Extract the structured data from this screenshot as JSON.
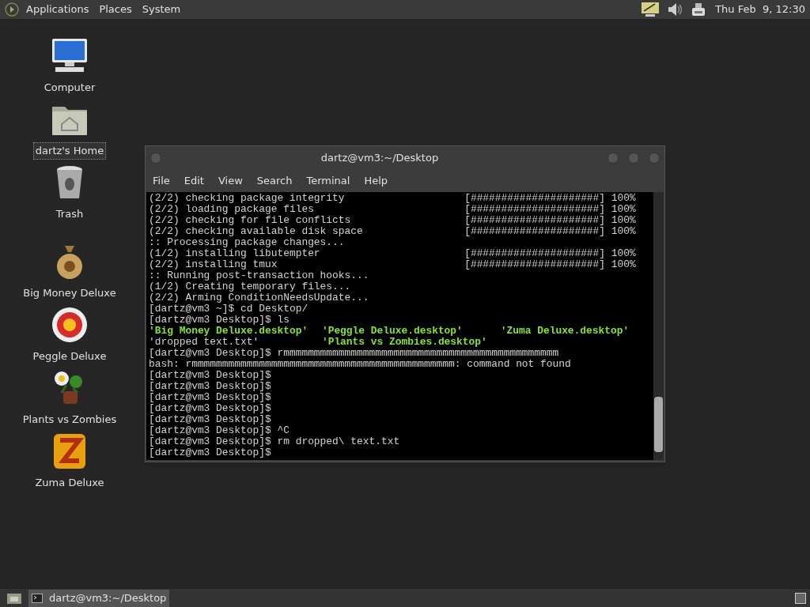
{
  "top_panel": {
    "menus": [
      "Applications",
      "Places",
      "System"
    ],
    "clock": "Thu Feb  9, 12:30"
  },
  "desktop_icons": [
    {
      "kind": "computer",
      "label": "Computer",
      "selected": false
    },
    {
      "kind": "home",
      "label": "dartz's Home",
      "selected": true
    },
    {
      "kind": "trash",
      "label": "Trash",
      "selected": false
    },
    {
      "kind": "money",
      "label": "Big Money Deluxe",
      "selected": false
    },
    {
      "kind": "peggle",
      "label": "Peggle Deluxe",
      "selected": false
    },
    {
      "kind": "plants",
      "label": "Plants vs Zombies",
      "selected": false
    },
    {
      "kind": "zuma",
      "label": "Zuma Deluxe",
      "selected": false
    }
  ],
  "terminal": {
    "title": "dartz@vm3:~/Desktop",
    "menu": [
      "File",
      "Edit",
      "View",
      "Search",
      "Terminal",
      "Help"
    ],
    "lines": [
      {
        "text": "(2/2) checking package integrity",
        "progress": "[#####################]",
        "percent": "100%"
      },
      {
        "text": "(2/2) loading package files",
        "progress": "[#####################]",
        "percent": "100%"
      },
      {
        "text": "(2/2) checking for file conflicts",
        "progress": "[#####################]",
        "percent": "100%"
      },
      {
        "text": "(2/2) checking available disk space",
        "progress": "[#####################]",
        "percent": "100%"
      },
      {
        "text": ":: Processing package changes..."
      },
      {
        "text": "(1/2) installing libutempter",
        "progress": "[#####################]",
        "percent": "100%"
      },
      {
        "text": "(2/2) installing tmux",
        "progress": "[#####################]",
        "percent": "100%"
      },
      {
        "text": ":: Running post-transaction hooks..."
      },
      {
        "text": "(1/2) Creating temporary files..."
      },
      {
        "text": "(2/2) Arming ConditionNeedsUpdate..."
      },
      {
        "text": "[dartz@vm3 ~]$ cd Desktop/"
      },
      {
        "text": "[dartz@vm3 Desktop]$ ls"
      },
      {
        "files": [
          {
            "text": "'Big Money Deluxe.desktop'",
            "executable": true
          },
          {
            "text": "'Peggle Deluxe.desktop'",
            "executable": true
          },
          {
            "text": "'Zuma Deluxe.desktop'",
            "executable": true
          }
        ]
      },
      {
        "files": [
          {
            "text": "'dropped text.txt'",
            "executable": false
          },
          {
            "text": "'Plants vs Zombies.desktop'",
            "executable": true
          }
        ]
      },
      {
        "text": "[dartz@vm3 Desktop]$ rmmmmmmmmmmmmmmmmmmmmmmmmmmmmmmmmmmmmmmmmmmmmm"
      },
      {
        "text": "bash: rmmmmmmmmmmmmmmmmmmmmmmmmmmmmmmmmmmmmmmmmmmm: command not found"
      },
      {
        "text": "[dartz@vm3 Desktop]$"
      },
      {
        "text": "[dartz@vm3 Desktop]$"
      },
      {
        "text": "[dartz@vm3 Desktop]$"
      },
      {
        "text": "[dartz@vm3 Desktop]$"
      },
      {
        "text": "[dartz@vm3 Desktop]$"
      },
      {
        "text": "[dartz@vm3 Desktop]$ ^C"
      },
      {
        "text": "[dartz@vm3 Desktop]$ rm dropped\\ text.txt"
      },
      {
        "text": "[dartz@vm3 Desktop]$"
      }
    ]
  },
  "taskbar": {
    "tasks": [
      {
        "label": "dartz@vm3:~/Desktop",
        "selected": true
      }
    ]
  }
}
